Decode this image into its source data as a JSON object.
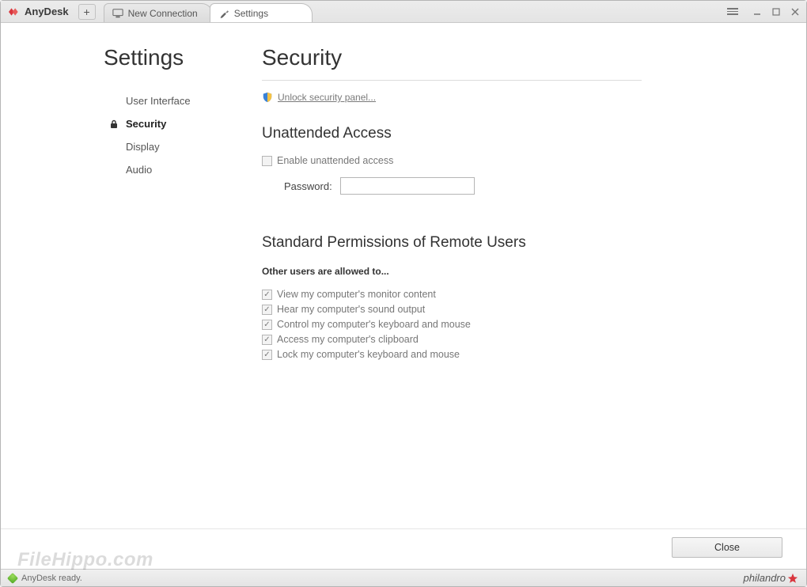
{
  "app": {
    "name": "AnyDesk"
  },
  "tabs": [
    {
      "label": "New Connection"
    },
    {
      "label": "Settings"
    }
  ],
  "sidebar": {
    "heading": "Settings",
    "items": [
      {
        "label": "User Interface"
      },
      {
        "label": "Security"
      },
      {
        "label": "Display"
      },
      {
        "label": "Audio"
      }
    ]
  },
  "main": {
    "heading": "Security",
    "unlock_label": "Unlock security panel...",
    "unattended": {
      "title": "Unattended Access",
      "enable_label": "Enable unattended access",
      "password_label": "Password:",
      "password_value": ""
    },
    "permissions": {
      "title": "Standard Permissions of Remote Users",
      "subtitle": "Other users are allowed to...",
      "items": [
        "View my computer's monitor content",
        "Hear my computer's sound output",
        "Control my computer's keyboard and mouse",
        "Access my computer's clipboard",
        "Lock my computer's keyboard and mouse"
      ]
    }
  },
  "buttons": {
    "close": "Close"
  },
  "status": {
    "text": "AnyDesk ready."
  },
  "brand": {
    "footer": "philandro"
  },
  "watermark": "FileHippo.com"
}
